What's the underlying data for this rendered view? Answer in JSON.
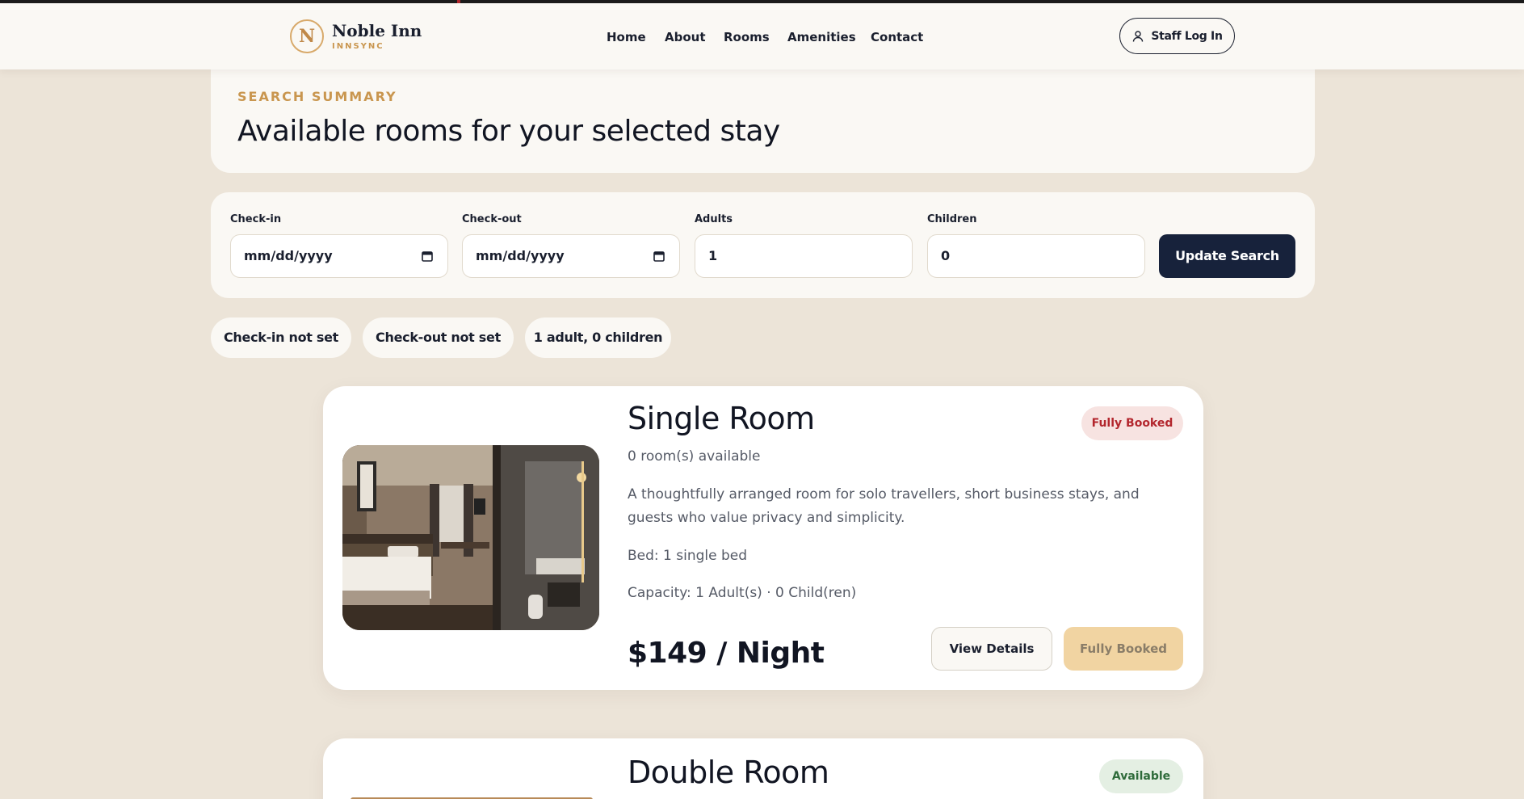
{
  "brand": {
    "logo_letter": "N",
    "name": "Noble Inn",
    "subtitle": "INNSYNC"
  },
  "nav": {
    "links": [
      "Home",
      "About",
      "Rooms",
      "Amenities",
      "Contact"
    ],
    "staff_login": "Staff Log In"
  },
  "summary": {
    "eyebrow": "SEARCH SUMMARY",
    "title": "Available rooms for your selected stay"
  },
  "search": {
    "checkin_label": "Check-in",
    "checkin_value": "mm/dd/yyyy",
    "checkout_label": "Check-out",
    "checkout_value": "mm/dd/yyyy",
    "adults_label": "Adults",
    "adults_value": "1",
    "children_label": "Children",
    "children_value": "0",
    "submit_label": "Update Search"
  },
  "chips": [
    "Check-in not set",
    "Check-out not set",
    "1 adult, 0 children"
  ],
  "rooms": [
    {
      "title": "Single Room",
      "status": "Fully Booked",
      "status_color": "#b3262d",
      "status_bg": "#f7e3e1",
      "availability": "0 room(s) available",
      "description": "A thoughtfully arranged room for solo travellers, short business stays, and guests who value privacy and simplicity.",
      "bed": "Bed: 1 single bed",
      "capacity": "Capacity: 1 Adult(s) · 0 Child(ren)",
      "price": "$149 / Night",
      "details_label": "View Details",
      "book_label": "Fully Booked"
    },
    {
      "title": "Double Room",
      "status": "Available",
      "status_color": "#2e6b3a",
      "status_bg": "#e4efe3"
    }
  ],
  "colors": {
    "accent_gold": "#c9964f",
    "navy": "#17223b",
    "background": "#ece4d8"
  }
}
